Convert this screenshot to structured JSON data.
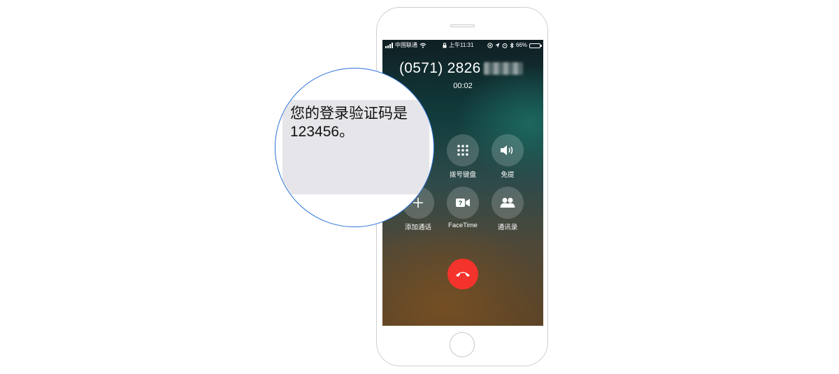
{
  "status_bar": {
    "carrier": "中国联通",
    "time": "上午11:31",
    "battery": "66%",
    "battery_level": 0.66,
    "battery_color": "#f5d000"
  },
  "call": {
    "number": "(0571) 2826",
    "duration": "00:02"
  },
  "controls": {
    "keypad_label": "拨号键盘",
    "speaker_label": "免提",
    "add_call_label": "添加通话",
    "facetime_label": "FaceTime",
    "contacts_label": "通讯录",
    "end_call_color": "#f4332c"
  },
  "sms": {
    "line1": "您的登录验证码是",
    "line2": "123456。"
  },
  "icons": [
    "signal-icon",
    "wifi-icon",
    "lock-icon",
    "location-icon",
    "alarm-icon",
    "bluetooth-icon",
    "battery-icon",
    "keypad-icon",
    "speaker-icon",
    "add-icon",
    "facetime-icon",
    "contacts-icon",
    "end-call-icon"
  ],
  "accent": "#2b73d6"
}
